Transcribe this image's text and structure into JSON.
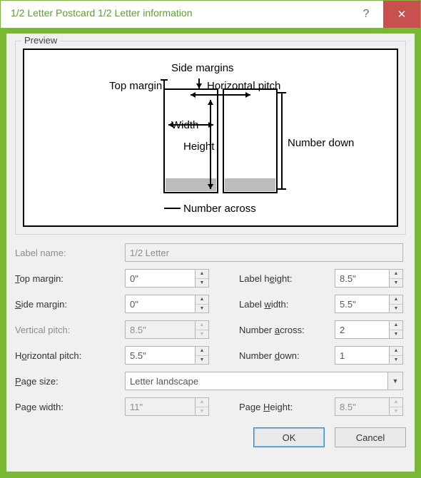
{
  "title": "1/2 Letter Postcard 1/2 Letter information",
  "preview": {
    "legend": "Preview",
    "labels": {
      "side_margins": "Side margins",
      "top_margin": "Top margin",
      "horizontal_pitch": "Horizontal pitch",
      "width": "Width",
      "height": "Height",
      "number_down": "Number down",
      "number_across": "Number across"
    }
  },
  "fields": {
    "label_name": {
      "label": "Label name:",
      "value": "1/2 Letter"
    },
    "top_margin": {
      "label_pre": "",
      "label_u": "T",
      "label_post": "op margin:",
      "value": "0\""
    },
    "side_margin": {
      "label_pre": "",
      "label_u": "S",
      "label_post": "ide margin:",
      "value": "0\""
    },
    "vertical_pitch": {
      "label": "Vertical pitch:",
      "value": "8.5\""
    },
    "horizontal_pitch": {
      "label_pre": "H",
      "label_u": "o",
      "label_post": "rizontal pitch:",
      "value": "5.5\""
    },
    "label_height": {
      "label_pre": "Label h",
      "label_u": "e",
      "label_post": "ight:",
      "value": "8.5\""
    },
    "label_width": {
      "label_pre": "Label ",
      "label_u": "w",
      "label_post": "idth:",
      "value": "5.5\""
    },
    "number_across": {
      "label_pre": "Number ",
      "label_u": "a",
      "label_post": "cross:",
      "value": "2"
    },
    "number_down": {
      "label_pre": "Number ",
      "label_u": "d",
      "label_post": "own:",
      "value": "1"
    },
    "page_size": {
      "label_pre": "",
      "label_u": "P",
      "label_post": "age size:",
      "value": "Letter landscape"
    },
    "page_width": {
      "label": "Page width:",
      "value": "11\""
    },
    "page_height": {
      "label_pre": "Page ",
      "label_u": "H",
      "label_post": "eight:",
      "value": "8.5\""
    }
  },
  "buttons": {
    "ok": "OK",
    "cancel": "Cancel"
  }
}
